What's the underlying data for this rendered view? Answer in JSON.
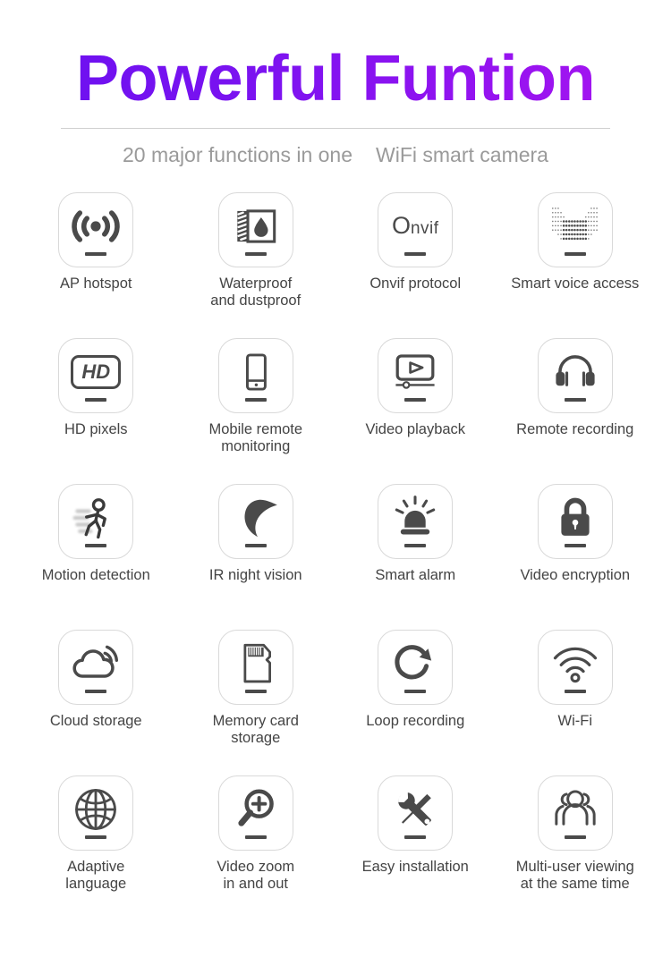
{
  "header": {
    "title": "Powerful Funtion",
    "subtitle_left": "20 major functions in one",
    "subtitle_right": "WiFi smart camera",
    "title_gradient_from": "#6a10f0",
    "title_gradient_to": "#a914f0",
    "subtitle_color": "#9a9a9a",
    "divider_color": "#cfcfcf"
  },
  "style": {
    "icon_color": "#4a4a4a",
    "tile_border_color": "#d9d9d9",
    "label_color": "#444444",
    "background": "#ffffff"
  },
  "features": [
    {
      "label": "AP hotspot",
      "icon": "broadcast-signal-icon"
    },
    {
      "label": "Waterproof\nand dustproof",
      "icon": "water-droplet-icon"
    },
    {
      "label": "Onvif protocol",
      "icon": "onvif-wordmark-icon",
      "onvif_big": "O",
      "onvif_small": "nvif"
    },
    {
      "label": "Smart voice access",
      "icon": "speaker-grille-icon"
    },
    {
      "label": "HD pixels",
      "icon": "hd-badge-icon",
      "hd_text": "HD"
    },
    {
      "label": "Mobile remote\nmonitoring",
      "icon": "smartphone-icon"
    },
    {
      "label": "Video playback",
      "icon": "video-player-icon"
    },
    {
      "label": "Remote recording",
      "icon": "headphones-icon"
    },
    {
      "label": "Motion detection",
      "icon": "running-person-icon"
    },
    {
      "label": "IR night vision",
      "icon": "crescent-moon-icon"
    },
    {
      "label": "Smart alarm",
      "icon": "siren-light-icon"
    },
    {
      "label": "Video encryption",
      "icon": "padlock-icon"
    },
    {
      "label": "Cloud storage",
      "icon": "cloud-signal-icon"
    },
    {
      "label": "Memory card\nstorage",
      "icon": "microsd-card-icon"
    },
    {
      "label": "Loop recording",
      "icon": "circular-arrow-icon"
    },
    {
      "label": "Wi-Fi",
      "icon": "wifi-icon"
    },
    {
      "label": "Adaptive\nlanguage",
      "icon": "globe-icon"
    },
    {
      "label": "Video zoom\nin and out",
      "icon": "magnifier-plus-icon"
    },
    {
      "label": "Easy installation",
      "icon": "wrench-screwdriver-icon"
    },
    {
      "label": "Multi-user viewing\nat the same time",
      "icon": "people-group-icon"
    }
  ]
}
